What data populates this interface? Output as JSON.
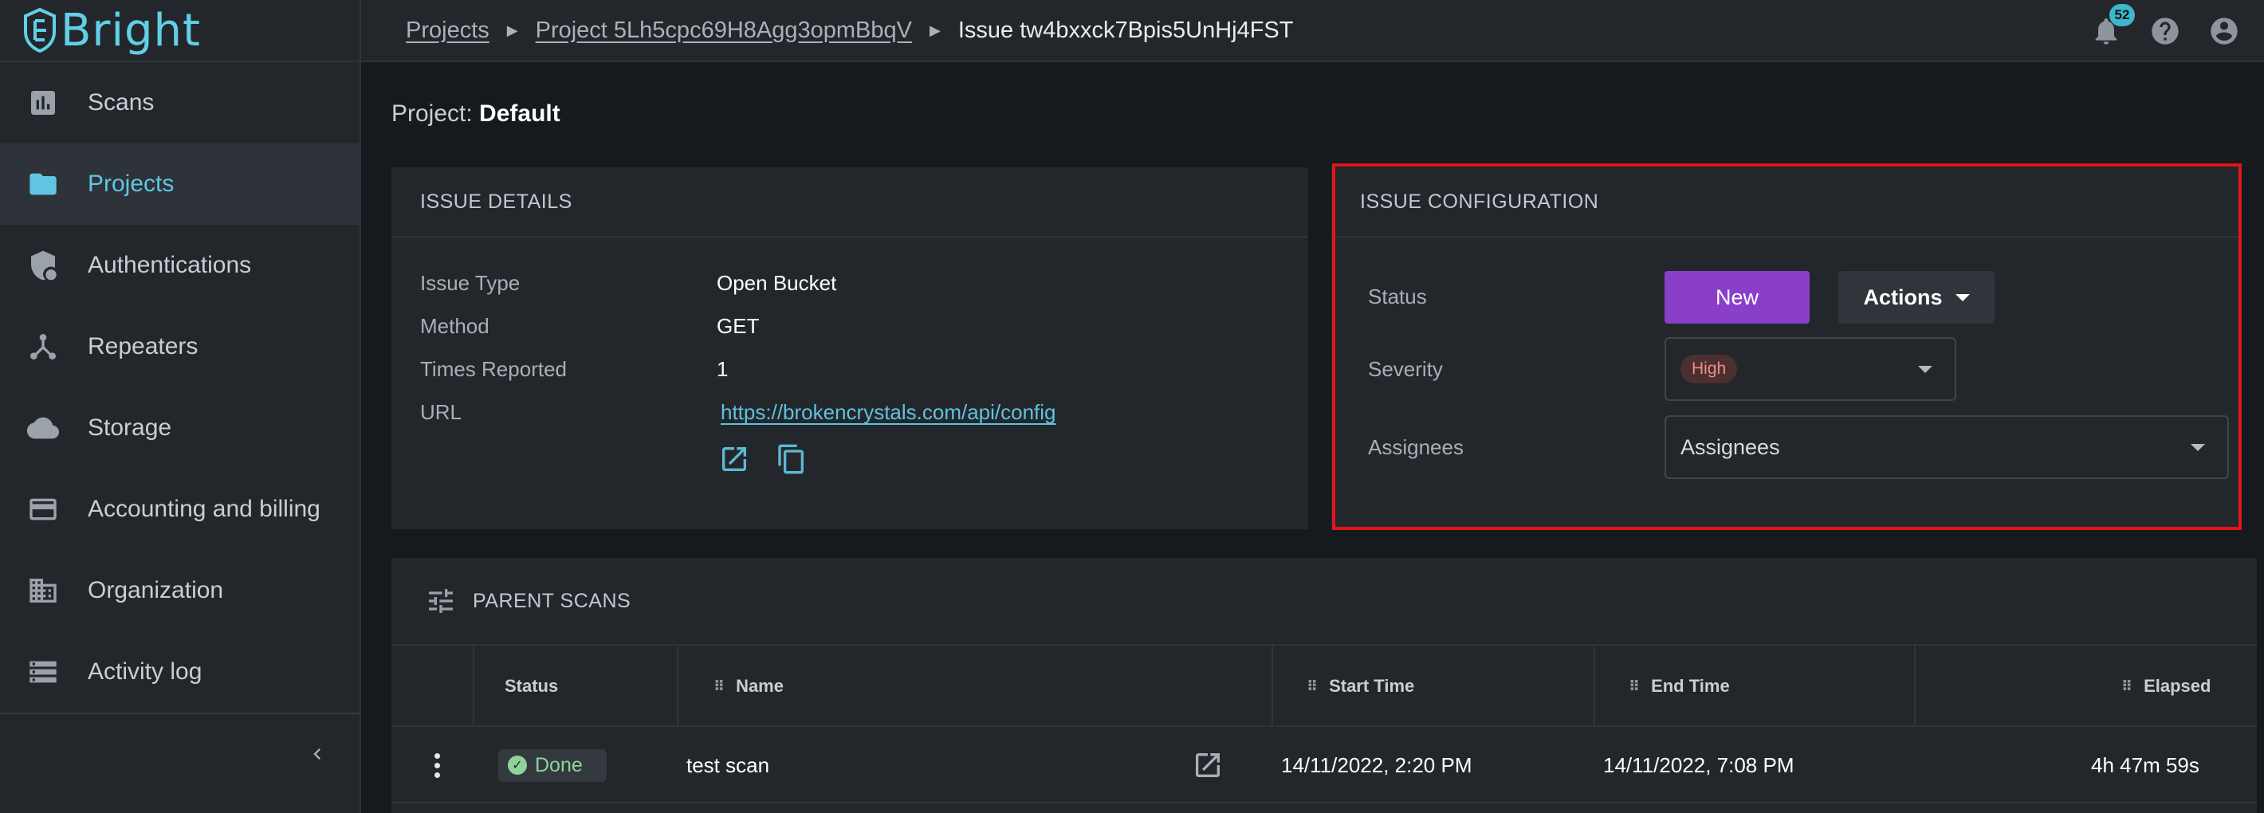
{
  "app": {
    "logo_text": "Bright"
  },
  "sidebar": {
    "items": [
      {
        "label": "Scans",
        "icon": "bar-chart-icon",
        "active": false
      },
      {
        "label": "Projects",
        "icon": "folder-icon",
        "active": true
      },
      {
        "label": "Authentications",
        "icon": "shield-lock-icon",
        "active": false
      },
      {
        "label": "Repeaters",
        "icon": "repeater-hub-icon",
        "active": false
      },
      {
        "label": "Storage",
        "icon": "cloud-icon",
        "active": false
      },
      {
        "label": "Accounting and billing",
        "icon": "credit-card-icon",
        "active": false
      },
      {
        "label": "Organization",
        "icon": "building-icon",
        "active": false
      },
      {
        "label": "Activity log",
        "icon": "list-storage-icon",
        "active": false
      }
    ],
    "collapse_icon": "chevron-left-icon"
  },
  "breadcrumb": {
    "items": [
      "Projects",
      "Project 5Lh5cpc69H8Agg3opmBbqV"
    ],
    "current": "Issue tw4bxxck7Bpis5UnHj4FST"
  },
  "topbar": {
    "notification_count": "52",
    "icons": [
      "bell-icon",
      "help-icon",
      "account-icon"
    ]
  },
  "project": {
    "prefix": "Project: ",
    "name": "Default"
  },
  "issue_details": {
    "title": "ISSUE DETAILS",
    "rows": [
      {
        "label": "Issue Type",
        "value": "Open Bucket"
      },
      {
        "label": "Method",
        "value": "GET"
      },
      {
        "label": "Times Reported",
        "value": "1"
      },
      {
        "label": "URL",
        "value": "https://brokencrystals.com/api/config"
      }
    ]
  },
  "issue_config": {
    "title": "ISSUE CONFIGURATION",
    "status_label": "Status",
    "status_value": "New",
    "actions_label": "Actions",
    "severity_label": "Severity",
    "severity_value": "High",
    "assignees_label": "Assignees",
    "assignees_placeholder": "Assignees"
  },
  "colors": {
    "accent": "#61c5e2",
    "status_new": "#8a3fc9",
    "severity_high": "#f08d89",
    "highlight": "#e0161b",
    "done": "#8fd39a"
  },
  "parent_scans": {
    "title": "PARENT SCANS",
    "columns": [
      "Status",
      "Name",
      "Start Time",
      "End Time",
      "Elapsed"
    ],
    "rows": [
      {
        "status": "Done",
        "name": "test scan",
        "start": "14/11/2022, 2:20 PM",
        "end": "14/11/2022, 7:08 PM",
        "elapsed": "4h 47m 59s"
      }
    ]
  }
}
